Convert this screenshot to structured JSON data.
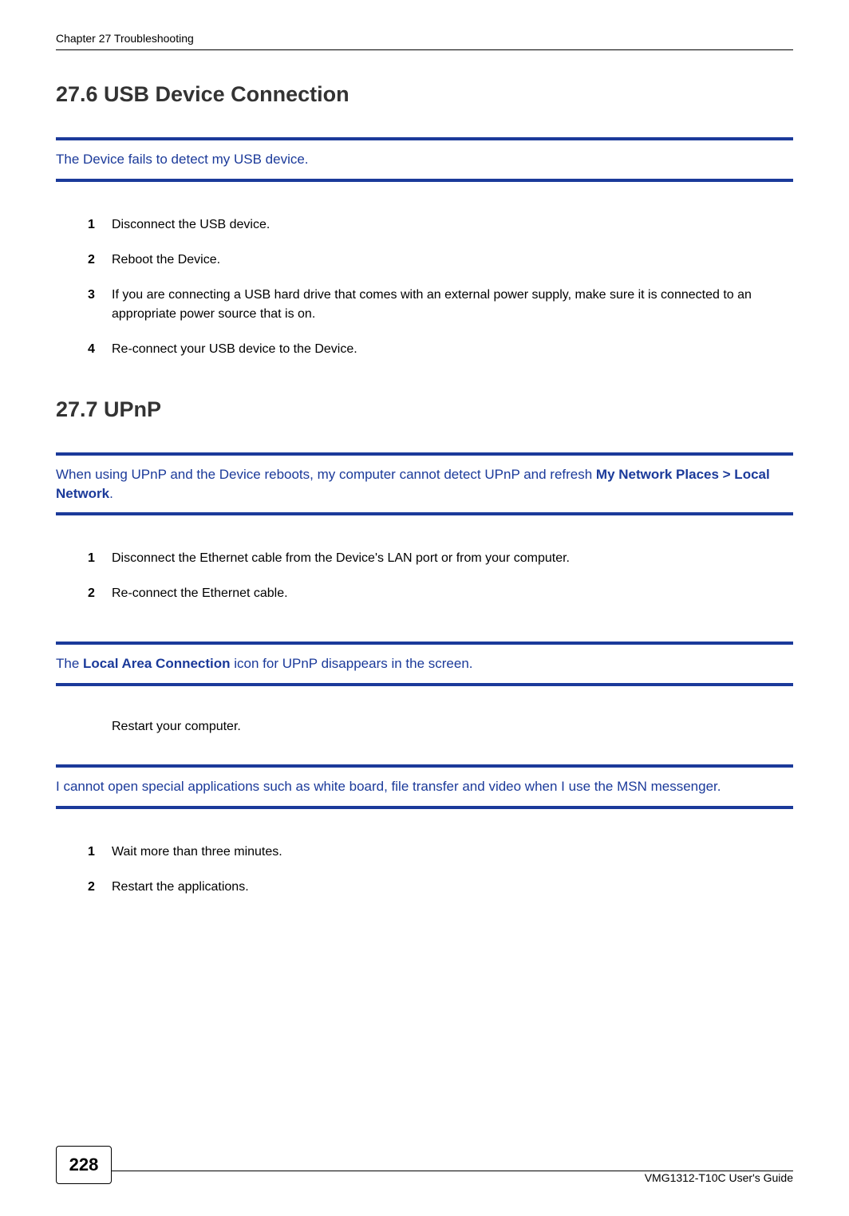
{
  "chapter_header": "Chapter 27 Troubleshooting",
  "sections": {
    "usb": {
      "heading": "27.6  USB Device Connection",
      "issue": "The Device fails to detect my USB device.",
      "steps": [
        "Disconnect the USB device.",
        "Reboot the Device.",
        "If you are connecting a USB hard drive that comes with an external power supply, make sure it is connected to an appropriate power source that is on.",
        "Re-connect your USB device to the Device."
      ]
    },
    "upnp": {
      "heading": "27.7  UPnP",
      "issue1_prefix": "When using UPnP and the Device reboots, my computer cannot detect UPnP and refresh ",
      "issue1_bold": "My Network Places > Local Network",
      "issue1_suffix": ".",
      "steps1": [
        "Disconnect the Ethernet cable from the Device's LAN port or from your computer.",
        "Re-connect the Ethernet cable."
      ],
      "issue2_prefix": "The ",
      "issue2_bold": "Local Area Connection",
      "issue2_suffix": " icon for UPnP disappears in the screen.",
      "answer2": "Restart your computer.",
      "issue3": "I cannot open special applications such as white board, file transfer and video when I use the MSN messenger.",
      "steps3": [
        "Wait more than three minutes.",
        "Restart the applications."
      ]
    }
  },
  "footer": {
    "page_number": "228",
    "guide_title": "VMG1312-T10C User's Guide"
  }
}
